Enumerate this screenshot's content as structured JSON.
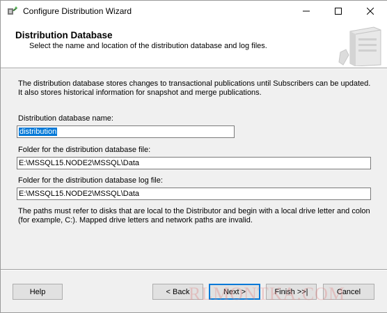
{
  "window": {
    "title": "Configure Distribution Wizard",
    "controls": {
      "minimize": "minimize",
      "maximize": "maximize",
      "close": "close"
    }
  },
  "header": {
    "title": "Distribution Database",
    "subtitle": "Select the name and location of the distribution database and log files."
  },
  "description": "The distribution database stores changes to transactional publications until Subscribers can be updated. It also stores historical information for snapshot and merge publications.",
  "fields": {
    "db_name_label": "Distribution database name:",
    "db_name_value": "distribution",
    "db_folder_label": "Folder for the distribution database file:",
    "db_folder_value": "E:\\MSSQL15.NODE2\\MSSQL\\Data",
    "log_folder_label": "Folder for the distribution database log file:",
    "log_folder_value": "E:\\MSSQL15.NODE2\\MSSQL\\Data"
  },
  "note": "The paths must refer to disks that are local to the Distributor and begin with a local drive letter and colon (for example, C:). Mapped drive letters and network paths are invalid.",
  "buttons": {
    "help": "Help",
    "back": "< Back",
    "next": "Next >",
    "finish": "Finish >>|",
    "cancel": "Cancel"
  },
  "watermark": "RLMONTKA.COM",
  "colors": {
    "selection": "#0078d7",
    "default_button_border": "#0078d7"
  }
}
